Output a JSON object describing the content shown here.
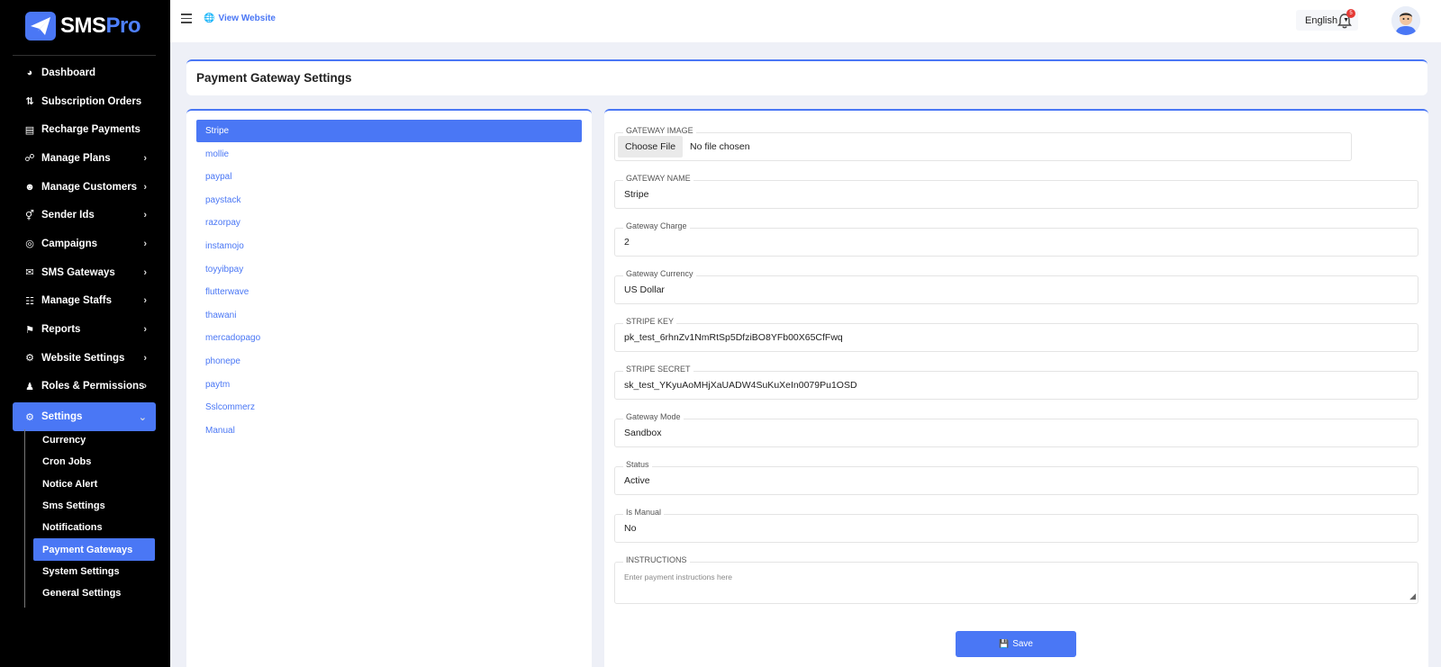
{
  "brand": {
    "name_part1": "SMS",
    "name_part2": "Pro",
    "accent": "#4a77f5"
  },
  "sidebar": {
    "items": [
      {
        "label": "Dashboard",
        "icon": "gauge-icon",
        "glyph": "◕",
        "has_children": false
      },
      {
        "label": "Subscription Orders",
        "icon": "sort-icon",
        "glyph": "⇅",
        "has_children": false
      },
      {
        "label": "Recharge Payments",
        "icon": "receipt-icon",
        "glyph": "▤",
        "has_children": false
      },
      {
        "label": "Manage Plans",
        "icon": "walking-icon",
        "glyph": "☍",
        "has_children": true
      },
      {
        "label": "Manage Customers",
        "icon": "users-icon",
        "glyph": "☻",
        "has_children": true
      },
      {
        "label": "Sender Ids",
        "icon": "gender-icon",
        "glyph": "⚥",
        "has_children": true
      },
      {
        "label": "Campaigns",
        "icon": "target-icon",
        "glyph": "◎",
        "has_children": true
      },
      {
        "label": "SMS Gateways",
        "icon": "chat-icon",
        "glyph": "✉",
        "has_children": true
      },
      {
        "label": "Manage Staffs",
        "icon": "staff-icon",
        "glyph": "☷",
        "has_children": true
      },
      {
        "label": "Reports",
        "icon": "flag-icon",
        "glyph": "⚑",
        "has_children": true
      },
      {
        "label": "Website Settings",
        "icon": "cogs-icon",
        "glyph": "⚙",
        "has_children": true
      },
      {
        "label": "Roles & Permissions",
        "icon": "user-lock-icon",
        "glyph": "♟",
        "has_children": true
      },
      {
        "label": "Settings",
        "icon": "gear-icon",
        "glyph": "⚙",
        "has_children": true,
        "active": true
      }
    ],
    "settings_sub": [
      {
        "label": "Currency"
      },
      {
        "label": "Cron Jobs"
      },
      {
        "label": "Notice Alert"
      },
      {
        "label": "Sms Settings"
      },
      {
        "label": "Notifications"
      },
      {
        "label": "Payment Gateways",
        "active": true
      },
      {
        "label": "System Settings"
      },
      {
        "label": "General Settings"
      }
    ]
  },
  "topbar": {
    "view_website": "View Website",
    "language": "English",
    "notification_count": "5"
  },
  "page": {
    "title": "Payment Gateway Settings"
  },
  "gateways": [
    "Stripe",
    "mollie",
    "paypal",
    "paystack",
    "razorpay",
    "instamojo",
    "toyyibpay",
    "flutterwave",
    "thawani",
    "mercadopago",
    "phonepe",
    "paytm",
    "Sslcommerz",
    "Manual"
  ],
  "form": {
    "image": {
      "label": "GATEWAY IMAGE",
      "button": "Choose File",
      "status": "No file chosen"
    },
    "name": {
      "label": "GATEWAY NAME",
      "value": "Stripe"
    },
    "charge": {
      "label": "Gateway Charge",
      "value": "2"
    },
    "currency": {
      "label": "Gateway Currency",
      "value": "US Dollar"
    },
    "key": {
      "label": "STRIPE KEY",
      "value": "pk_test_6rhnZv1NmRtSp5DfziBO8YFb00X65CfFwq"
    },
    "secret": {
      "label": "STRIPE SECRET",
      "value": "sk_test_YKyuAoMHjXaUADW4SuKuXeIn0079Pu1OSD"
    },
    "mode": {
      "label": "Gateway Mode",
      "value": "Sandbox"
    },
    "status": {
      "label": "Status",
      "value": "Active"
    },
    "manual": {
      "label": "Is Manual",
      "value": "No"
    },
    "instructions": {
      "label": "INSTRUCTIONS",
      "placeholder": "Enter payment instructions here"
    },
    "save_label": "Save"
  }
}
